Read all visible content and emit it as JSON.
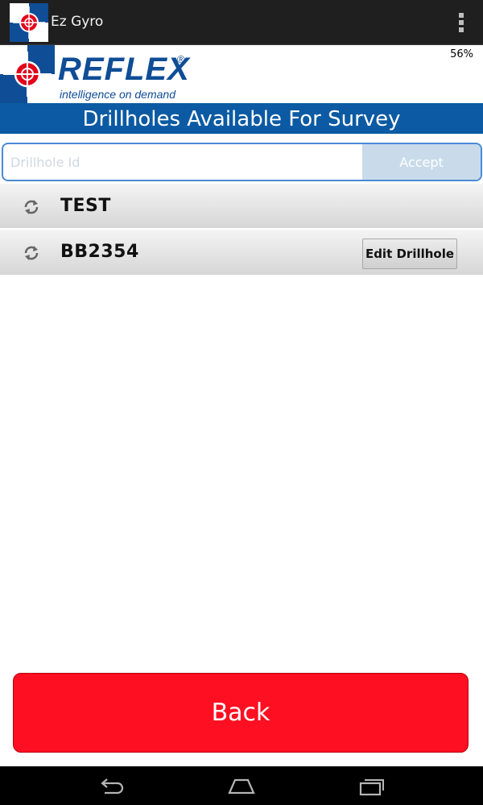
{
  "action_bar": {
    "app_title": "Ez Gyro",
    "icons": {
      "app": "reflex-crosshair-icon",
      "overflow": "overflow-menu-icon"
    }
  },
  "header": {
    "brand": "REFLEX",
    "registered_mark": "®",
    "tagline": "intelligence on demand",
    "battery": "56%"
  },
  "page_title": "Drillholes Available For Survey",
  "search": {
    "placeholder": "Drillhole Id",
    "value": "",
    "accept_label": "Accept"
  },
  "drillholes": [
    {
      "name": "TEST",
      "icon": "sync-icon",
      "action": ""
    },
    {
      "name": "BB2354",
      "icon": "sync-icon",
      "action": "Edit Drillhole"
    }
  ],
  "back_label": "Back",
  "nav_bar": {
    "icons": [
      "back-icon",
      "home-icon",
      "recent-apps-icon"
    ]
  },
  "colors": {
    "brand_blue": "#0f4d96",
    "title_band": "#0b5aa3",
    "back_button": "#ff0f22",
    "accept_button": "#c9dbea"
  }
}
